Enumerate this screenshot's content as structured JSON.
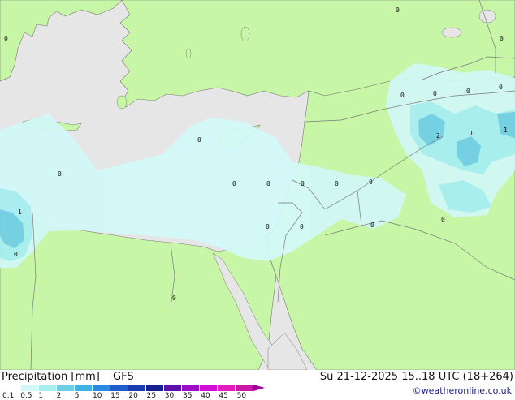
{
  "map": {
    "cell_values": [
      "0",
      "0",
      "0",
      "0",
      "0",
      "0",
      "0",
      "0",
      "0",
      "2",
      "1",
      "1",
      "0",
      "0",
      "0",
      "0",
      "0",
      "0",
      "0",
      "0",
      "0",
      "1",
      "0",
      "0"
    ],
    "colors": {
      "sea": "#e6e6e6",
      "land": "#c7f7a6",
      "precip_light": "#d2f8f8",
      "precip_mid": "#a5eef2",
      "precip_strong": "#6fcde8",
      "border": "#7a7a7a"
    }
  },
  "legend": {
    "title": "Precipitation [mm]",
    "model": "GFS",
    "run": "Su 21-12-2025 15..18 UTC (18+264)",
    "credit": "©weatheronline.co.uk",
    "scale_labels": [
      "0.1",
      "0.5",
      "1",
      "2",
      "5",
      "10",
      "15",
      "20",
      "25",
      "30",
      "35",
      "40",
      "45",
      "50"
    ],
    "scale_colors": [
      "#ffffff",
      "#d2f8f8",
      "#a5eef2",
      "#6fcde8",
      "#3fb2e6",
      "#2a8ae0",
      "#205ecc",
      "#1b3db0",
      "#16208f",
      "#5c11a8",
      "#9d0ec9",
      "#d10fd6",
      "#e41bbd",
      "#c918a3"
    ]
  }
}
